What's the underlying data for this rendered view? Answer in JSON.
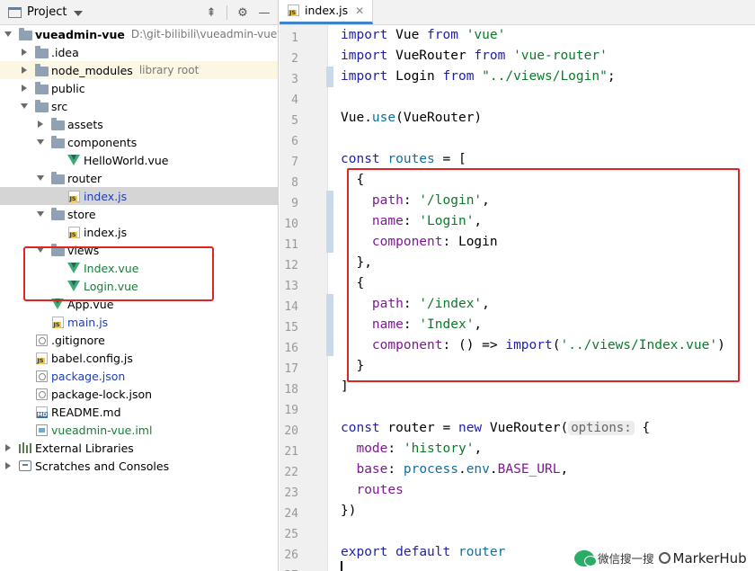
{
  "project_panel": {
    "title": "Project",
    "tree": [
      {
        "label": "vueadmin-vue",
        "hint": "D:\\git-bilibili\\vueadmin-vue"
      },
      {
        "label": ".idea"
      },
      {
        "label": "node_modules",
        "hint": "library root"
      },
      {
        "label": "public"
      },
      {
        "label": "src"
      },
      {
        "label": "assets"
      },
      {
        "label": "components"
      },
      {
        "label": "HelloWorld.vue"
      },
      {
        "label": "router"
      },
      {
        "label": "index.js"
      },
      {
        "label": "store"
      },
      {
        "label": "index.js"
      },
      {
        "label": "views"
      },
      {
        "label": "Index.vue"
      },
      {
        "label": "Login.vue"
      },
      {
        "label": "App.vue"
      },
      {
        "label": "main.js"
      },
      {
        "label": ".gitignore"
      },
      {
        "label": "babel.config.js"
      },
      {
        "label": "package.json"
      },
      {
        "label": "package-lock.json"
      },
      {
        "label": "README.md"
      },
      {
        "label": "vueadmin-vue.iml"
      },
      {
        "label": "External Libraries"
      },
      {
        "label": "Scratches and Consoles"
      }
    ]
  },
  "editor": {
    "tab_label": "index.js",
    "line_numbers": [
      "1",
      "2",
      "3",
      "4",
      "5",
      "6",
      "7",
      "8",
      "9",
      "10",
      "11",
      "12",
      "13",
      "14",
      "15",
      "16",
      "17",
      "18",
      "19",
      "20",
      "21",
      "22",
      "23",
      "24",
      "25",
      "26",
      "27"
    ],
    "code": {
      "l1": {
        "a": "import",
        "b": " Vue ",
        "c": "from",
        "d": " ",
        "e": "'vue'"
      },
      "l2": {
        "a": "import",
        "b": " VueRouter ",
        "c": "from",
        "d": " ",
        "e": "'vue-router'"
      },
      "l3": {
        "a": "import",
        "b": " Login ",
        "c": "from",
        "d": " ",
        "e": "\"../views/Login\"",
        "f": ";"
      },
      "l5": {
        "a": "Vue.",
        "b": "use",
        "c": "(VueRouter)"
      },
      "l7": {
        "a": "const",
        "b": " ",
        "c": "routes",
        "d": " = ["
      },
      "l8": "  {",
      "l9": {
        "a": "    ",
        "b": "path",
        "c": ": ",
        "d": "'/login'",
        "e": ","
      },
      "l10": {
        "a": "    ",
        "b": "name",
        "c": ": ",
        "d": "'Login'",
        "e": ","
      },
      "l11": {
        "a": "    ",
        "b": "component",
        "c": ": Login"
      },
      "l12": "  },",
      "l13": "  {",
      "l14": {
        "a": "    ",
        "b": "path",
        "c": ": ",
        "d": "'/index'",
        "e": ","
      },
      "l15": {
        "a": "    ",
        "b": "name",
        "c": ": ",
        "d": "'Index'",
        "e": ","
      },
      "l16": {
        "a": "    ",
        "b": "component",
        "c": ": () => ",
        "d": "import",
        "e": "(",
        "f": "'../views/Index.vue'",
        "g": ")"
      },
      "l17": "  }",
      "l18": "]",
      "l20": {
        "a": "const",
        "b": " router = ",
        "c": "new",
        "d": " VueRouter(",
        "e": "options:",
        "f": " {"
      },
      "l21": {
        "a": "  ",
        "b": "mode",
        "c": ": ",
        "d": "'history'",
        "e": ","
      },
      "l22": {
        "a": "  ",
        "b": "base",
        "c": ": ",
        "d": "process",
        "e": ".",
        "f": "env",
        "g": ".",
        "h": "BASE_URL",
        "i": ","
      },
      "l23": {
        "a": "  ",
        "b": "routes"
      },
      "l24": "})",
      "l26": {
        "a": "export",
        "b": " ",
        "c": "default",
        "d": " ",
        "e": "router"
      }
    }
  },
  "watermark": {
    "text": "微信搜一搜",
    "name": "MarkerHub"
  },
  "colors": {
    "highlight_box": "#e02424",
    "keyword": "#1f1faa",
    "string": "#0b7a2b",
    "property": "#7b1b8f"
  }
}
